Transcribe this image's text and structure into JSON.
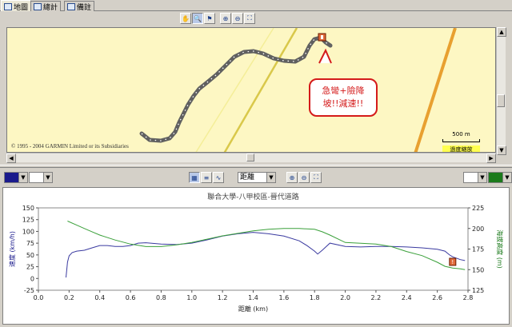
{
  "tabs": [
    {
      "label": "地圖",
      "icon": "map-icon"
    },
    {
      "label": "總計",
      "icon": "table-icon"
    },
    {
      "label": "備註",
      "icon": "note-icon"
    }
  ],
  "map": {
    "toolbar_icons": [
      "hand-icon",
      "zoom-select-icon",
      "flag-icon",
      "zoom-in-icon",
      "zoom-out-icon",
      "fit-icon"
    ],
    "copyright": "© 1995 - 2004 GARMIN Limited or its Subsidiaries",
    "scale_label": "500 m",
    "zoom_label": "過度縮放",
    "callout_line1": "急彎+險降",
    "callout_line2": "坡!!減速!!",
    "colors": {
      "background": "#fdf7c3",
      "road": "#e8a030",
      "road2": "#d9c84a",
      "track": "#606060",
      "callout": "#d41a1a"
    }
  },
  "chart_toolbar": {
    "icons": [
      "grid-icon",
      "list-icon",
      "curve-icon",
      "zoom-in-icon",
      "zoom-out-icon",
      "fit-icon"
    ],
    "x_select": "距離",
    "left_color": "#1a1a8c",
    "right_color": "#1b7a1b"
  },
  "chart_data": {
    "type": "line",
    "title": "聯合大學-八甲校區-晉代道路",
    "xlabel": "距離 (km)",
    "ylabel": "速度 (km/h)",
    "y2label": "海拔高度 (m)",
    "xlim": [
      0,
      2.8
    ],
    "ylim": [
      -25,
      150
    ],
    "y2lim": [
      125,
      225
    ],
    "x_ticks": [
      "0.0",
      "0.2",
      "0.4",
      "0.6",
      "0.8",
      "1.0",
      "1.2",
      "1.4",
      "1.6",
      "1.8",
      "2.0",
      "2.2",
      "2.4",
      "2.6",
      "2.8"
    ],
    "y_ticks": [
      "-25",
      "0",
      "25",
      "50",
      "75",
      "100",
      "125",
      "150"
    ],
    "y2_ticks": [
      "125",
      "150",
      "175",
      "200",
      "225"
    ],
    "series": [
      {
        "name": "速度",
        "axis": "left",
        "color": "#3a3aa0",
        "x": [
          0.18,
          0.19,
          0.2,
          0.22,
          0.25,
          0.3,
          0.35,
          0.4,
          0.45,
          0.5,
          0.55,
          0.6,
          0.65,
          0.7,
          0.8,
          0.9,
          1.0,
          1.1,
          1.2,
          1.3,
          1.4,
          1.5,
          1.6,
          1.7,
          1.75,
          1.8,
          1.82,
          1.85,
          1.9,
          2.0,
          2.1,
          2.2,
          2.3,
          2.4,
          2.5,
          2.6,
          2.65,
          2.68,
          2.7,
          2.75,
          2.78
        ],
        "y": [
          2,
          35,
          48,
          55,
          58,
          60,
          65,
          70,
          70,
          68,
          68,
          70,
          75,
          76,
          73,
          72,
          75,
          82,
          90,
          95,
          98,
          95,
          90,
          80,
          70,
          58,
          52,
          60,
          75,
          68,
          67,
          68,
          68,
          67,
          65,
          62,
          58,
          50,
          46,
          40,
          38
        ]
      },
      {
        "name": "海拔高度",
        "axis": "right",
        "color": "#3aa03a",
        "x": [
          0.19,
          0.25,
          0.3,
          0.35,
          0.4,
          0.5,
          0.6,
          0.7,
          0.8,
          0.9,
          1.0,
          1.1,
          1.2,
          1.3,
          1.4,
          1.5,
          1.6,
          1.7,
          1.8,
          1.85,
          1.9,
          2.0,
          2.1,
          2.2,
          2.3,
          2.4,
          2.5,
          2.6,
          2.65,
          2.7,
          2.75,
          2.78
        ],
        "y": [
          209,
          204,
          200,
          196,
          192,
          186,
          181,
          178,
          178,
          180,
          183,
          187,
          191,
          194,
          197,
          199,
          200,
          200,
          199,
          196,
          192,
          183,
          182,
          181,
          178,
          172,
          167,
          159,
          154,
          152,
          151,
          150
        ]
      }
    ],
    "marker": {
      "x": 2.7,
      "label": "!"
    }
  }
}
